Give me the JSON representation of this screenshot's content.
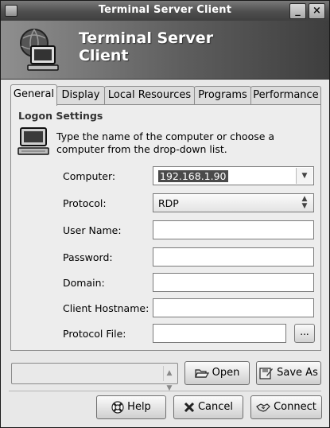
{
  "window": {
    "title": "Terminal Server Client",
    "minimize_label": "_",
    "close_label": "×"
  },
  "banner": {
    "line1": "Terminal Server",
    "line2": "Client"
  },
  "tabs": [
    {
      "label": "General",
      "active": true
    },
    {
      "label": "Display",
      "active": false
    },
    {
      "label": "Local Resources",
      "active": false
    },
    {
      "label": "Programs",
      "active": false
    },
    {
      "label": "Performance",
      "active": false
    }
  ],
  "logon": {
    "section_title": "Logon Settings",
    "instructions": "Type the name of the computer or choose a computer from the drop-down list.",
    "computer_label": "Computer:",
    "computer_value": "192.168.1.90",
    "protocol_label": "Protocol:",
    "protocol_value": "RDP",
    "username_label": "User Name:",
    "username_value": "",
    "password_label": "Password:",
    "password_value": "",
    "domain_label": "Domain:",
    "domain_value": "",
    "client_hostname_label": "Client Hostname:",
    "client_hostname_value": "",
    "protocol_file_label": "Protocol File:",
    "protocol_file_value": "",
    "browse_label": "..."
  },
  "profile": {
    "selected": "",
    "open_label": "Open",
    "save_as_label": "Save As"
  },
  "actions": {
    "help_label": "Help",
    "cancel_label": "Cancel",
    "connect_label": "Connect"
  },
  "icons": {
    "app": "computer-icon",
    "banner": "monitor-globe-icon",
    "section": "computer-icon",
    "open": "folder-open-icon",
    "save_as": "save-as-icon",
    "help": "help-lifebuoy-icon",
    "cancel": "cancel-x-icon",
    "connect": "connect-handshake-icon"
  }
}
